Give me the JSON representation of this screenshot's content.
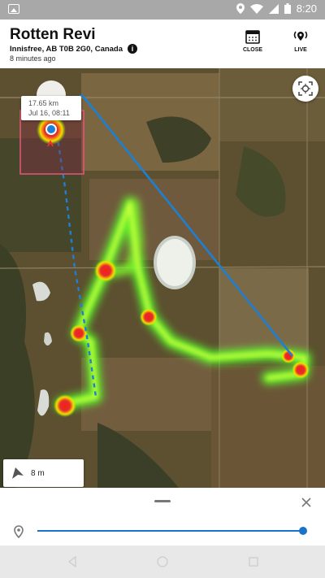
{
  "status_bar": {
    "time": "8:20"
  },
  "header": {
    "title": "Rotten Revi",
    "address": "Innisfree, AB T0B 2G0, Canada",
    "updated": "8 minutes ago",
    "close_label": "CLOSE",
    "live_label": "LIVE"
  },
  "map": {
    "popup": {
      "distance": "17.65 km",
      "timestamp": "Jul 16, 08:11"
    },
    "accuracy_label": "8 m",
    "route_color": "#1f7fd0",
    "heat_colors": [
      "#00ff00",
      "#ffff00",
      "#ff0000"
    ]
  },
  "colors": {
    "accent": "#1a73c8"
  }
}
